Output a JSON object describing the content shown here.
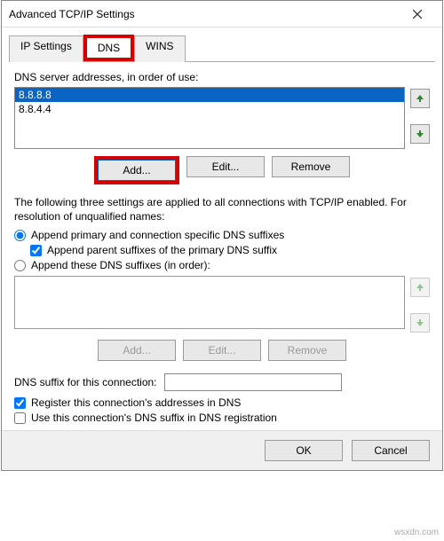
{
  "title": "Advanced TCP/IP Settings",
  "tabs": {
    "ip": "IP Settings",
    "dns": "DNS",
    "wins": "WINS"
  },
  "dns": {
    "server_label": "DNS server addresses, in order of use:",
    "servers": [
      "8.8.8.8",
      "8.8.4.4"
    ],
    "add": "Add...",
    "edit": "Edit...",
    "remove": "Remove",
    "note": "The following three settings are applied to all connections with TCP/IP enabled. For resolution of unqualified names:",
    "opt_primary": "Append primary and connection specific DNS suffixes",
    "opt_parent": "Append parent suffixes of the primary DNS suffix",
    "opt_these": "Append these DNS suffixes (in order):",
    "suffix_add": "Add...",
    "suffix_edit": "Edit...",
    "suffix_remove": "Remove",
    "suffix_label": "DNS suffix for this connection:",
    "register": "Register this connection's addresses in DNS",
    "use_suffix_reg": "Use this connection's DNS suffix in DNS registration"
  },
  "dialog": {
    "ok": "OK",
    "cancel": "Cancel"
  },
  "watermark": "wsxdn.com"
}
